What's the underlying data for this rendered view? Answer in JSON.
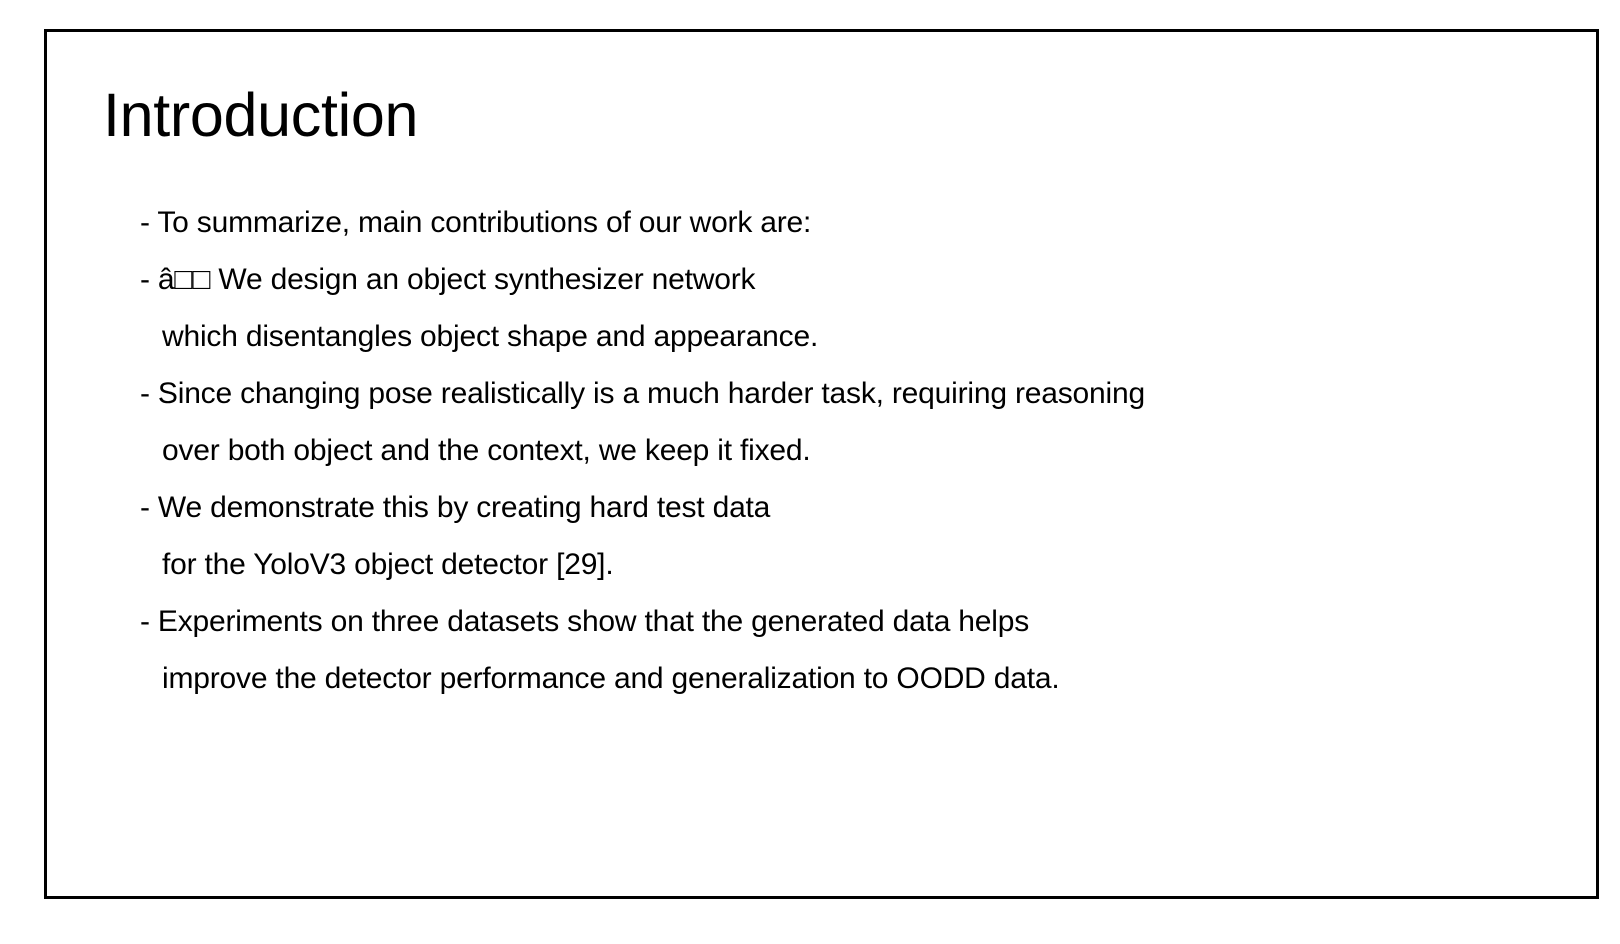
{
  "slide": {
    "title": "Introduction",
    "lines": [
      {
        "text": "- To summarize, main contributions of our work are:",
        "continuation": false
      },
      {
        "text": "- â□□ We design an object synthesizer network",
        "continuation": false
      },
      {
        "text": "which disentangles object shape and appearance.",
        "continuation": true
      },
      {
        "text": "- Since changing pose realistically is a much harder task, requiring reasoning",
        "continuation": false
      },
      {
        "text": "over both object and the context, we keep it fixed.",
        "continuation": true
      },
      {
        "text": "- We demonstrate this by creating hard test data",
        "continuation": false
      },
      {
        "text": "for the YoloV3 object detector [29].",
        "continuation": true
      },
      {
        "text": "- Experiments on three datasets show that the generated data helps",
        "continuation": false
      },
      {
        "text": "improve the detector performance and generalization to OODD data.",
        "continuation": true
      }
    ]
  },
  "colors": {
    "background": "#ffffff",
    "border": "#000000",
    "text": "#000000"
  }
}
